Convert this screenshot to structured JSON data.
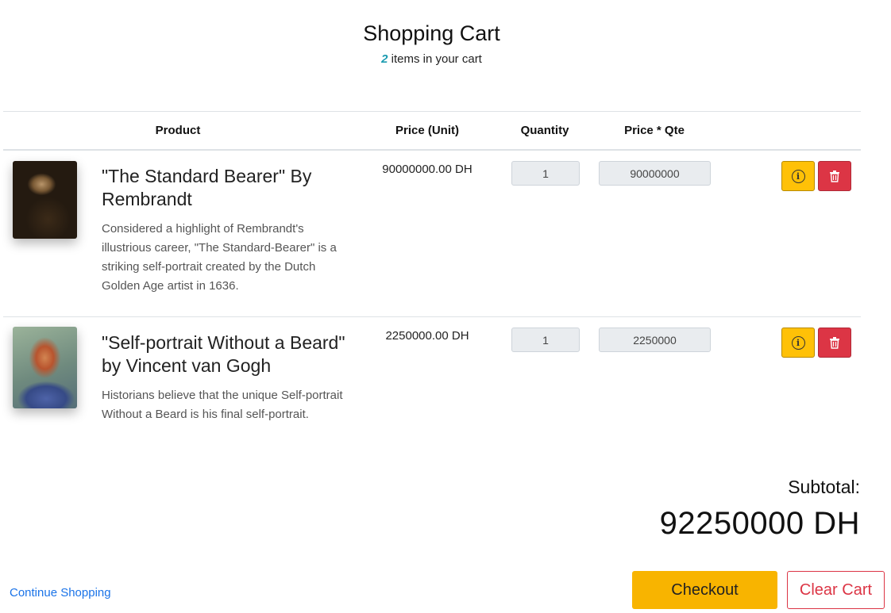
{
  "header": {
    "title": "Shopping Cart",
    "item_count": "2",
    "count_suffix": " items in your cart"
  },
  "table": {
    "headers": {
      "product": "Product",
      "price_unit": "Price (Unit)",
      "quantity": "Quantity",
      "price_qte": "Price * Qte"
    },
    "items": [
      {
        "title": "\"The Standard Bearer\" By Rembrandt",
        "description": "Considered a highlight of Rembrandt's illustrious career, \"The Standard-Bearer\" is a striking self-portrait created by the Dutch Golden Age artist in 1636.",
        "unit_price": "90000000.00 DH",
        "quantity": "1",
        "total": "90000000",
        "image_icon": "rembrandt-painting-thumbnail"
      },
      {
        "title": "\"Self-portrait Without a Beard\" by Vincent van Gogh",
        "description": "Historians believe that the unique Self-portrait Without a Beard is his final self-portrait.",
        "unit_price": "2250000.00 DH",
        "quantity": "1",
        "total": "2250000",
        "image_icon": "van-gogh-painting-thumbnail"
      }
    ],
    "row_actions": {
      "info_icon": "info-icon",
      "delete_icon": "trash-icon"
    }
  },
  "summary": {
    "subtotal_label": "Subtotal:",
    "subtotal_value": "92250000 DH"
  },
  "footer": {
    "continue_label": "Continue Shopping",
    "checkout_label": "Checkout",
    "clear_label": "Clear Cart"
  },
  "colors": {
    "accent_teal": "#1a9bb0",
    "warning_yellow": "#ffc107",
    "checkout_yellow": "#f8b400",
    "danger_red": "#dc3545",
    "link_blue": "#1a73e8"
  }
}
